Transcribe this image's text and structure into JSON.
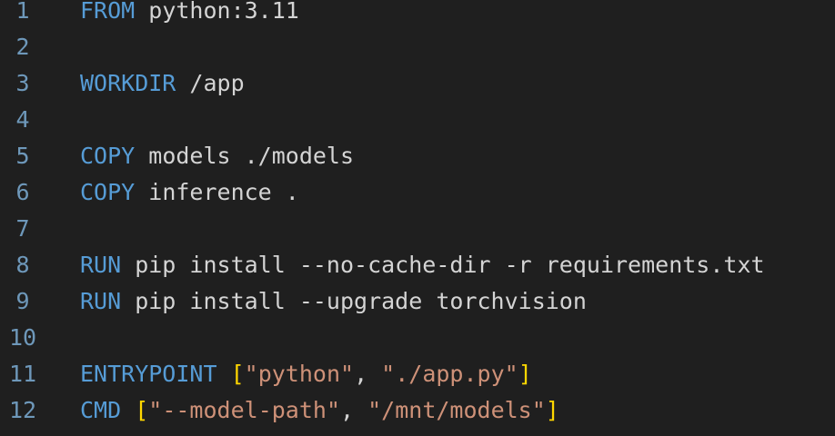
{
  "lines": [
    {
      "number": "1",
      "tokens": [
        {
          "t": "kw",
          "v": "FROM"
        },
        {
          "t": "tx",
          "v": " python:3.11"
        }
      ]
    },
    {
      "number": "2",
      "tokens": []
    },
    {
      "number": "3",
      "tokens": [
        {
          "t": "kw",
          "v": "WORKDIR"
        },
        {
          "t": "tx",
          "v": " /app"
        }
      ]
    },
    {
      "number": "4",
      "tokens": []
    },
    {
      "number": "5",
      "tokens": [
        {
          "t": "kw",
          "v": "COPY"
        },
        {
          "t": "tx",
          "v": " models ./models"
        }
      ]
    },
    {
      "number": "6",
      "tokens": [
        {
          "t": "kw",
          "v": "COPY"
        },
        {
          "t": "tx",
          "v": " inference ."
        }
      ]
    },
    {
      "number": "7",
      "tokens": []
    },
    {
      "number": "8",
      "tokens": [
        {
          "t": "kw",
          "v": "RUN"
        },
        {
          "t": "tx",
          "v": " pip install --no-cache-dir -r requirements.txt"
        }
      ]
    },
    {
      "number": "9",
      "tokens": [
        {
          "t": "kw",
          "v": "RUN"
        },
        {
          "t": "tx",
          "v": " pip install --upgrade torchvision"
        }
      ]
    },
    {
      "number": "10",
      "tokens": []
    },
    {
      "number": "11",
      "tokens": [
        {
          "t": "kw",
          "v": "ENTRYPOINT"
        },
        {
          "t": "tx",
          "v": " "
        },
        {
          "t": "br",
          "v": "["
        },
        {
          "t": "st",
          "v": "\"python\""
        },
        {
          "t": "pu",
          "v": ", "
        },
        {
          "t": "st",
          "v": "\"./app.py\""
        },
        {
          "t": "br",
          "v": "]"
        }
      ]
    },
    {
      "number": "12",
      "tokens": [
        {
          "t": "kw",
          "v": "CMD"
        },
        {
          "t": "tx",
          "v": " "
        },
        {
          "t": "br",
          "v": "["
        },
        {
          "t": "st",
          "v": "\"--model-path\""
        },
        {
          "t": "pu",
          "v": ", "
        },
        {
          "t": "st",
          "v": "\"/mnt/models\""
        },
        {
          "t": "br",
          "v": "]"
        }
      ]
    }
  ],
  "colors": {
    "background": "#1f1f1f",
    "line_number": "#6e98ba",
    "keyword": "#569cd6",
    "text": "#d4d4d4",
    "bracket": "#ffd700",
    "string": "#ce9178"
  }
}
